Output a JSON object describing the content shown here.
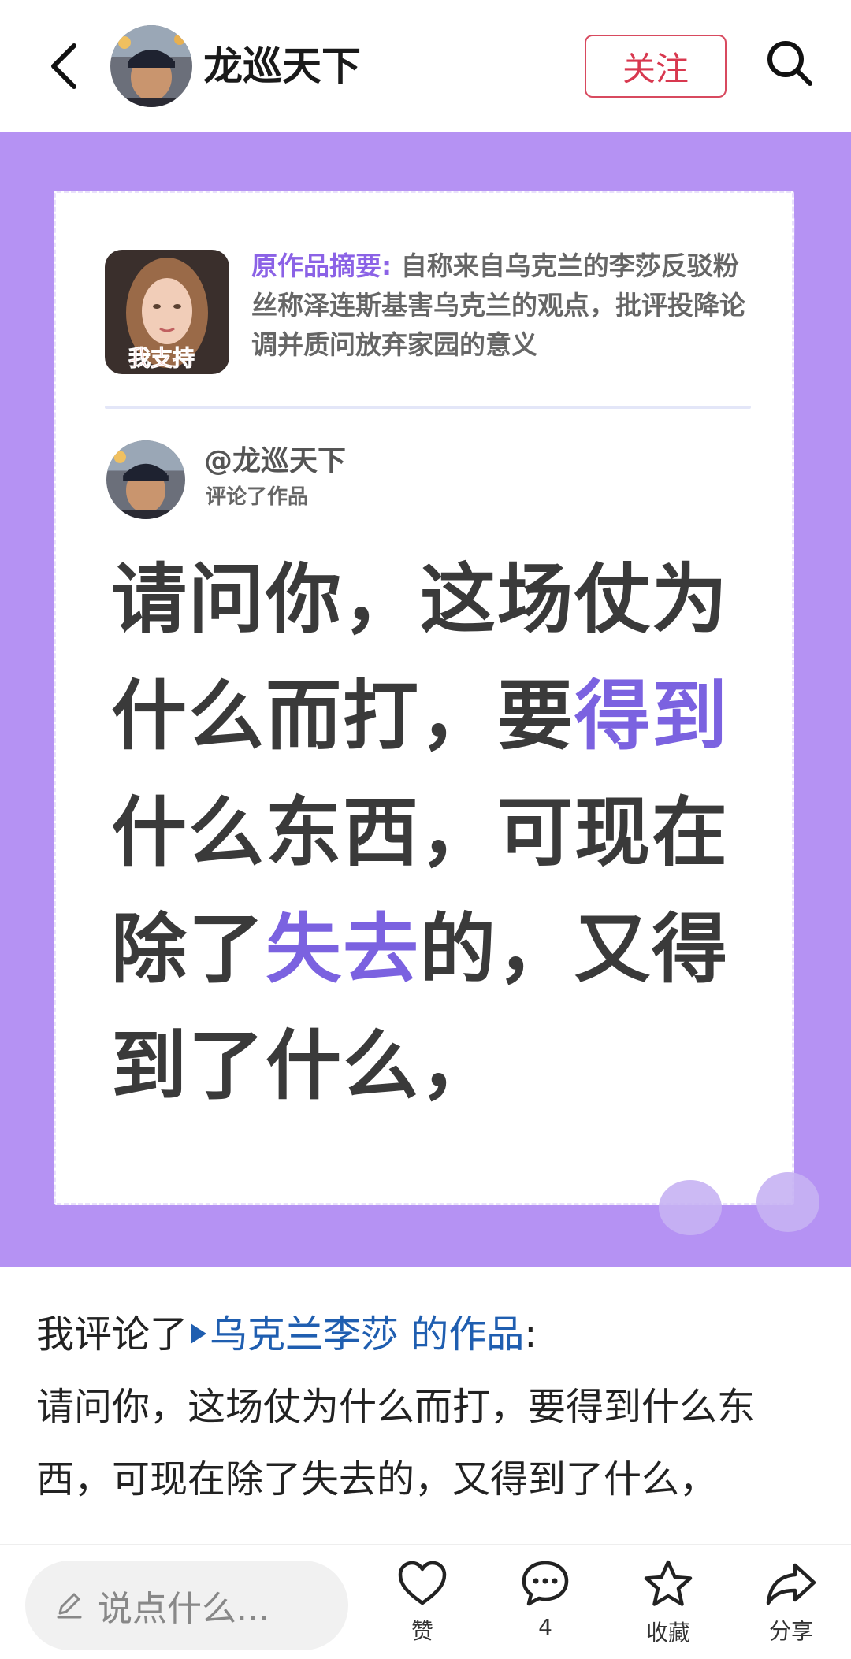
{
  "header": {
    "username": "龙巡天下",
    "follow_label": "关注"
  },
  "card": {
    "summary_label": "原作品摘要:",
    "summary_text": "自称来自乌克兰的李莎反驳粉丝称泽连斯基害乌克兰的观点，批评投降论调并质问放弃家园的意义",
    "thumb_caption": "我支持",
    "commenter_name": "@龙巡天下",
    "commenter_action": "评论了作品",
    "quote_parts": {
      "p1": "请问你，这场仗为什么而打，要",
      "h1": "得到",
      "p2": "什么东西，可现在除了",
      "h2": "失去",
      "p3": "的，又得到了什么，"
    }
  },
  "post": {
    "prefix": "我评论了",
    "link": "乌克兰李莎 的作品",
    "suffix": ":",
    "body": "请问你，这场仗为什么而打，要得到什么东西，可现在除了失去的，又得到了什么，"
  },
  "bottom": {
    "input_placeholder": "说点什么...",
    "like_label": "赞",
    "comment_count": "4",
    "favorite_label": "收藏",
    "share_label": "分享"
  },
  "colors": {
    "card_bg": "#b592f3",
    "highlight": "#7b62e0",
    "follow": "#d8384f",
    "link": "#1f5eb0"
  }
}
